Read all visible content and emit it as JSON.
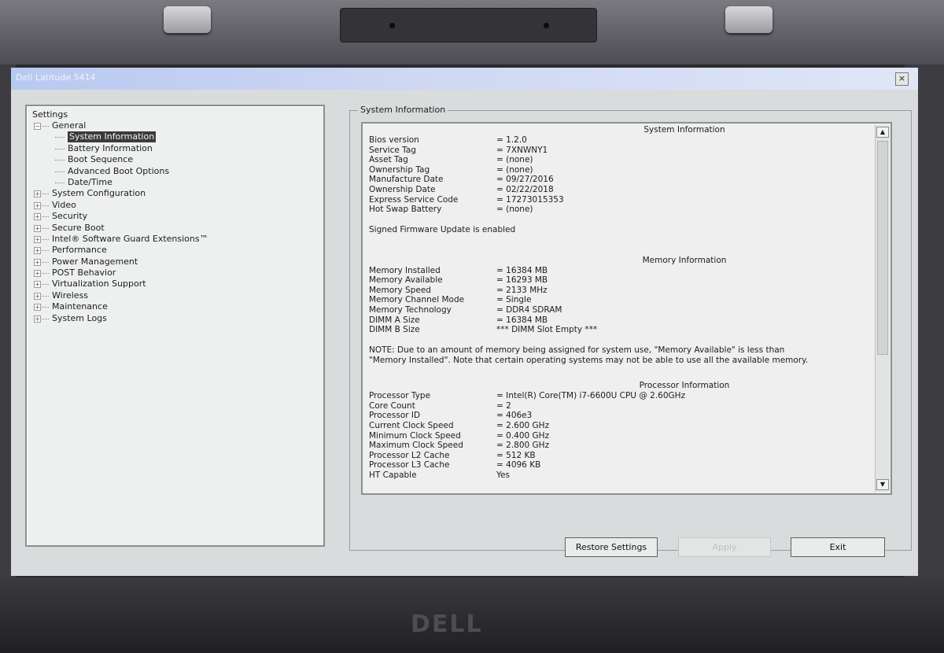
{
  "window": {
    "title": "Dell Latitude 5414",
    "close_symbol": "×"
  },
  "tree": {
    "root": "Settings",
    "items": [
      {
        "label": "General",
        "expander": "−",
        "level": 0
      },
      {
        "label": "System Information",
        "level": 1,
        "selected": true
      },
      {
        "label": "Battery Information",
        "level": 1
      },
      {
        "label": "Boot Sequence",
        "level": 1
      },
      {
        "label": "Advanced Boot Options",
        "level": 1
      },
      {
        "label": "Date/Time",
        "level": 1
      },
      {
        "label": "System Configuration",
        "expander": "+",
        "level": 0
      },
      {
        "label": "Video",
        "expander": "+",
        "level": 0
      },
      {
        "label": "Security",
        "expander": "+",
        "level": 0
      },
      {
        "label": "Secure Boot",
        "expander": "+",
        "level": 0
      },
      {
        "label": "Intel® Software Guard Extensions™",
        "expander": "+",
        "level": 0
      },
      {
        "label": "Performance",
        "expander": "+",
        "level": 0
      },
      {
        "label": "Power Management",
        "expander": "+",
        "level": 0
      },
      {
        "label": "POST Behavior",
        "expander": "+",
        "level": 0
      },
      {
        "label": "Virtualization Support",
        "expander": "+",
        "level": 0
      },
      {
        "label": "Wireless",
        "expander": "+",
        "level": 0
      },
      {
        "label": "Maintenance",
        "expander": "+",
        "level": 0
      },
      {
        "label": "System Logs",
        "expander": "+",
        "level": 0
      }
    ]
  },
  "panel": {
    "group_title": "System Information",
    "sections": [
      {
        "title": "System Information",
        "rows": [
          {
            "k": "Bios version",
            "v": "= 1.2.0"
          },
          {
            "k": "Service Tag",
            "v": "= 7XNWNY1"
          },
          {
            "k": "Asset Tag",
            "v": "= (none)"
          },
          {
            "k": "Ownership Tag",
            "v": "= (none)"
          },
          {
            "k": "Manufacture Date",
            "v": "= 09/27/2016"
          },
          {
            "k": "Ownership Date",
            "v": "= 02/22/2018"
          },
          {
            "k": "Express Service Code",
            "v": "= 17273015353"
          },
          {
            "k": "Hot Swap Battery",
            "v": "= (none)"
          }
        ],
        "note": "Signed Firmware Update is enabled"
      },
      {
        "title": "Memory Information",
        "rows": [
          {
            "k": "Memory Installed",
            "v": "= 16384 MB"
          },
          {
            "k": "Memory Available",
            "v": "= 16293 MB"
          },
          {
            "k": "Memory Speed",
            "v": "= 2133 MHz"
          },
          {
            "k": "Memory Channel Mode",
            "v": "= Single"
          },
          {
            "k": "Memory Technology",
            "v": "= DDR4 SDRAM"
          },
          {
            "k": "DIMM A Size",
            "v": "= 16384 MB"
          },
          {
            "k": "DIMM B Size",
            "v": "*** DIMM Slot Empty ***"
          }
        ],
        "note": "NOTE: Due to an amount of memory being assigned for system use, \"Memory Available\" is less than \"Memory Installed\". Note that certain operating systems may not be able to use all the available memory."
      },
      {
        "title": "Processor Information",
        "rows": [
          {
            "k": "Processor Type",
            "v": "= Intel(R) Core(TM) i7-6600U CPU @ 2.60GHz"
          },
          {
            "k": "Core Count",
            "v": "= 2"
          },
          {
            "k": "Processor ID",
            "v": "= 406e3"
          },
          {
            "k": "Current Clock Speed",
            "v": "= 2.600 GHz"
          },
          {
            "k": "Minimum Clock Speed",
            "v": "= 0.400 GHz"
          },
          {
            "k": "Maximum Clock Speed",
            "v": "= 2.800 GHz"
          },
          {
            "k": "Processor L2 Cache",
            "v": "= 512 KB"
          },
          {
            "k": "Processor L3 Cache",
            "v": "= 4096 KB"
          },
          {
            "k": "HT Capable",
            "v": "Yes"
          }
        ]
      }
    ]
  },
  "buttons": {
    "restore": "Restore Settings",
    "apply": "Apply",
    "exit": "Exit"
  },
  "bezel": {
    "logo": "DELL"
  },
  "icons": {
    "scroll_up": "▲",
    "scroll_down": "▼"
  }
}
